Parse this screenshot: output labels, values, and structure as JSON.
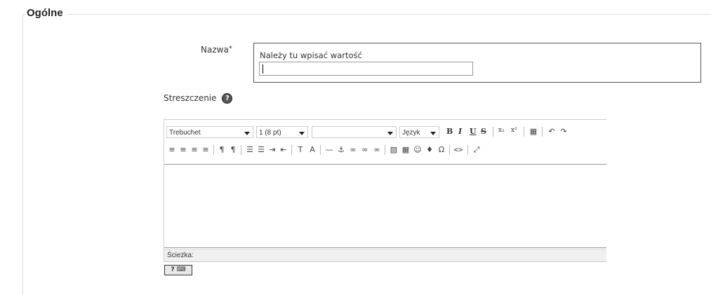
{
  "fieldset": {
    "legend": "Ogólne"
  },
  "name_field": {
    "label": "Nazwa",
    "required_mark": "*",
    "error": "Należy tu wpisać wartość",
    "value": ""
  },
  "summary": {
    "label": "Streszczenie",
    "help_icon": "help-icon"
  },
  "editor": {
    "font_family": "Trebuchet",
    "font_size": "1 (8 pt)",
    "style": "",
    "language": "Język",
    "path_label": "Ścieżka:",
    "toolbar_row1": [
      "B",
      "I",
      "U",
      "S",
      "x₂",
      "x²",
      "▦",
      "↶",
      "↷"
    ],
    "toolbar_row2": [
      "≡",
      "≡",
      "≡",
      "≡",
      "¶",
      "¶",
      "☰",
      "☰",
      "⇥",
      "⇤",
      "T",
      "A",
      "—",
      "⚓",
      "∞",
      "∞",
      "∞",
      "▨",
      "▦",
      "☺",
      "♦",
      "Ω",
      "<>",
      "⤢"
    ]
  }
}
